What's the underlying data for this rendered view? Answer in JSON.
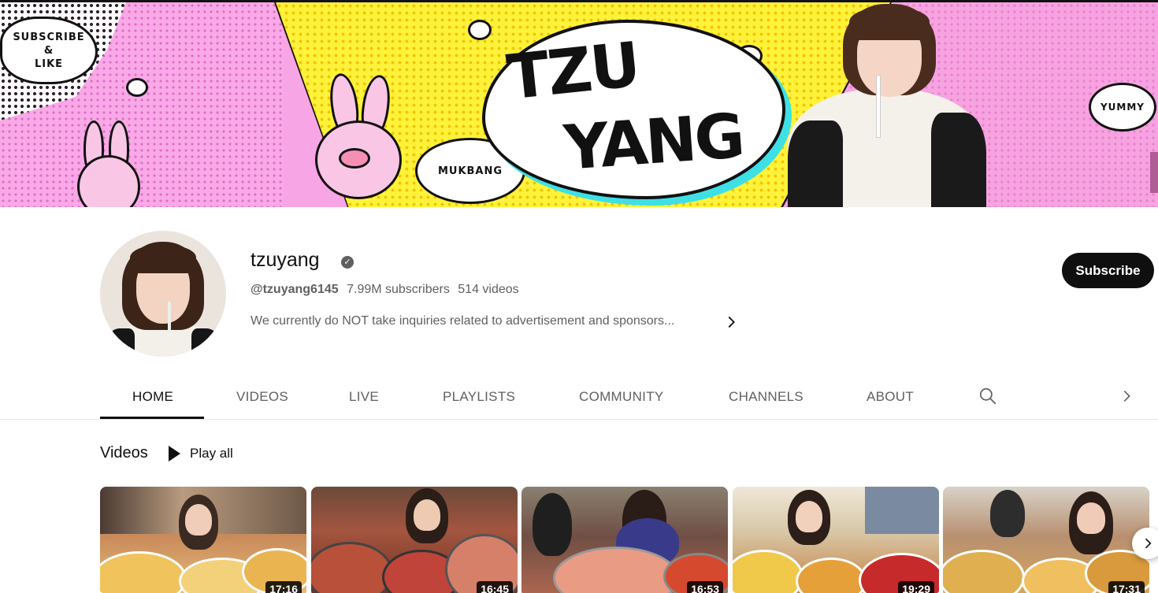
{
  "banner": {
    "subscribe_like": "SUBSCRIBE\n&\nLIKE",
    "mukbang": "MUKBANG",
    "yummy": "YUMMY",
    "title_line1": "TZU",
    "title_line2": "YANG"
  },
  "channel": {
    "name": "tzuyang",
    "verified_icon": "verified-check-icon",
    "handle": "@tzuyang6145",
    "subscribers": "7.99M subscribers",
    "video_count": "514 videos",
    "description": "We currently do NOT take inquiries related to advertisement and sponsors...",
    "subscribe_label": "Subscribe"
  },
  "tabs": [
    {
      "label": "HOME",
      "active": true
    },
    {
      "label": "VIDEOS"
    },
    {
      "label": "LIVE"
    },
    {
      "label": "PLAYLISTS"
    },
    {
      "label": "COMMUNITY"
    },
    {
      "label": "CHANNELS"
    },
    {
      "label": "ABOUT"
    }
  ],
  "tab_icons": {
    "search": "search-icon",
    "next": "chevron-right-icon"
  },
  "section": {
    "title": "Videos",
    "play_all": "Play all"
  },
  "videos": [
    {
      "duration": "17:16"
    },
    {
      "duration": "16:45"
    },
    {
      "duration": "16:53"
    },
    {
      "duration": "19:29"
    },
    {
      "duration": "17:31"
    }
  ],
  "colors": {
    "accent": "#0f0f0f",
    "secondary_text": "#606060",
    "banner_pink": "#f7a5e4",
    "banner_yellow": "#fff23a"
  }
}
